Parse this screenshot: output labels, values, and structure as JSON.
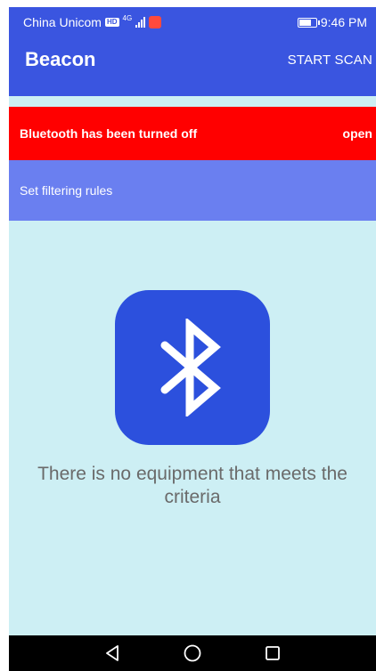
{
  "status_bar": {
    "carrier": "China Unicom",
    "hd_badge": "HD",
    "network_type": "4G",
    "time": "9:46 PM",
    "icons": [
      "hd-icon",
      "signal-icon",
      "app-notification-icon",
      "battery-icon"
    ]
  },
  "app_bar": {
    "title": "Beacon",
    "action_label": "START SCAN"
  },
  "bluetooth_alert": {
    "message": "Bluetooth has been turned off",
    "action_label": "open"
  },
  "filter": {
    "label": "Set filtering rules"
  },
  "empty_state": {
    "icon": "bluetooth-icon",
    "message": "There is no equipment that meets the criteria"
  },
  "nav_bar": {
    "icons": [
      "back-icon",
      "home-icon",
      "recents-icon"
    ]
  },
  "colors": {
    "primary": "#3a55e0",
    "alert": "#ff0000",
    "filter_bg": "#6a7ff0",
    "content_bg": "#cdeff4",
    "logo_bg": "#2c50dd",
    "nav_bg": "#000000"
  },
  "battery_level_percent": 80
}
